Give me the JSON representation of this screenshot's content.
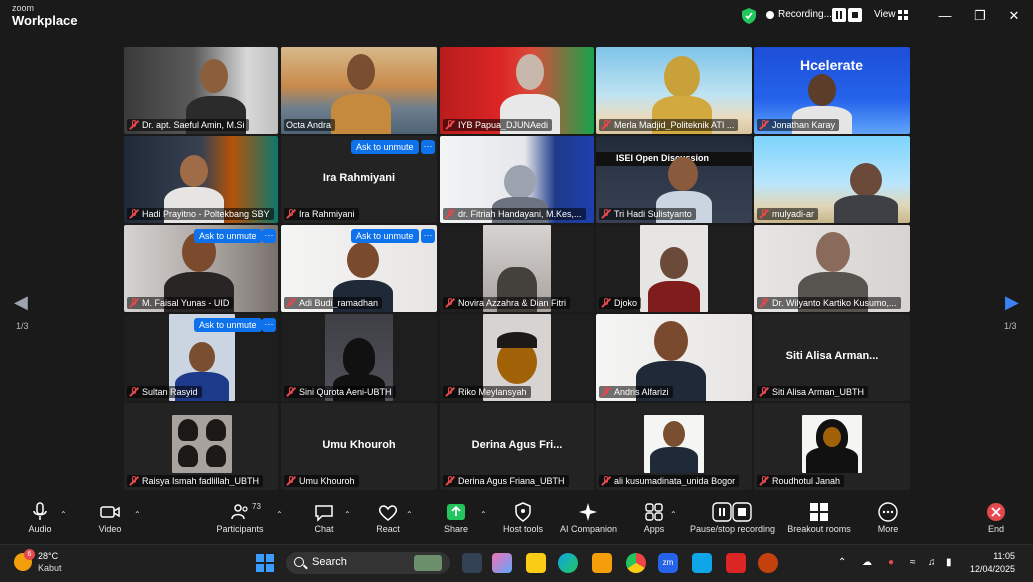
{
  "titlebar": {
    "brand_top": "zoom",
    "brand_bottom": "Workplace",
    "recording_label": "Recording...",
    "view_label": "View"
  },
  "pagination": {
    "left": "1/3",
    "right": "1/3"
  },
  "tiles": [
    {
      "name": "Dr. apt. Saeful Amin, M.Si"
    },
    {
      "name": "Octa Andra"
    },
    {
      "name": "IYB Papua_DJUNAedi"
    },
    {
      "name": "Merla Madjid_Politeknik ATI ..."
    },
    {
      "name": "Jonathan Karay",
      "overlay": "Hcelerate"
    },
    {
      "name": "Hadi Prayitno - Poltekbang SBY"
    },
    {
      "name": "Ira Rahmiyani",
      "center": "Ira Rahmiyani",
      "unmute": "Ask to unmute"
    },
    {
      "name": "dr. Fitriah Handayani, M.Kes,..."
    },
    {
      "name": "Tri Hadi Sulistyanto",
      "overlay": "ISEI Open Discussion"
    },
    {
      "name": "mulyadi-ar"
    },
    {
      "name": "M. Faisal Yunas - UID",
      "unmute": "Ask to unmute"
    },
    {
      "name": "Adi Budi_ramadhan",
      "unmute": "Ask to unmute"
    },
    {
      "name": "Novira Azzahra & Dian Fitri"
    },
    {
      "name": "Djoko"
    },
    {
      "name": "Dr. Wilyanto Kartiko Kusumo,..."
    },
    {
      "name": "Sultan Rasyid",
      "unmute": "Ask to unmute"
    },
    {
      "name": "Sini Qurota Aeni-UBTH"
    },
    {
      "name": "Riko Meylansyah"
    },
    {
      "name": "Andris Alfarizi"
    },
    {
      "name": "Siti Alisa Arman_UBTH",
      "center": "Siti Alisa Arman..."
    },
    {
      "name": "Raisya Ismah fadlillah_UBTH"
    },
    {
      "name": "Umu Khouroh",
      "center": "Umu Khouroh"
    },
    {
      "name": "Derina Agus Friana_UBTH",
      "center": "Derina Agus Fri..."
    },
    {
      "name": "ali kusumadinata_unida Bogor"
    },
    {
      "name": "Roudhotul Janah"
    }
  ],
  "more_glyph": "···",
  "toolbar": {
    "audio": "Audio",
    "video": "Video",
    "participants": "Participants",
    "participants_count": "73",
    "chat": "Chat",
    "react": "React",
    "share": "Share",
    "host_tools": "Host tools",
    "ai_companion": "AI Companion",
    "apps": "Apps",
    "pause_recording": "Pause/stop recording",
    "breakout_rooms": "Breakout rooms",
    "more": "More",
    "end": "End"
  },
  "taskbar": {
    "weather_temp": "28°C",
    "weather_desc": "Kabut",
    "notification_count": "6",
    "search_placeholder": "Search",
    "time": "11:05",
    "date": "12/04/2025"
  },
  "colors": {
    "active_speaker": "#34d399",
    "unmute_button": "#0e72ed",
    "muted_mic": "#e5484d",
    "record_end": "#e5484d"
  }
}
